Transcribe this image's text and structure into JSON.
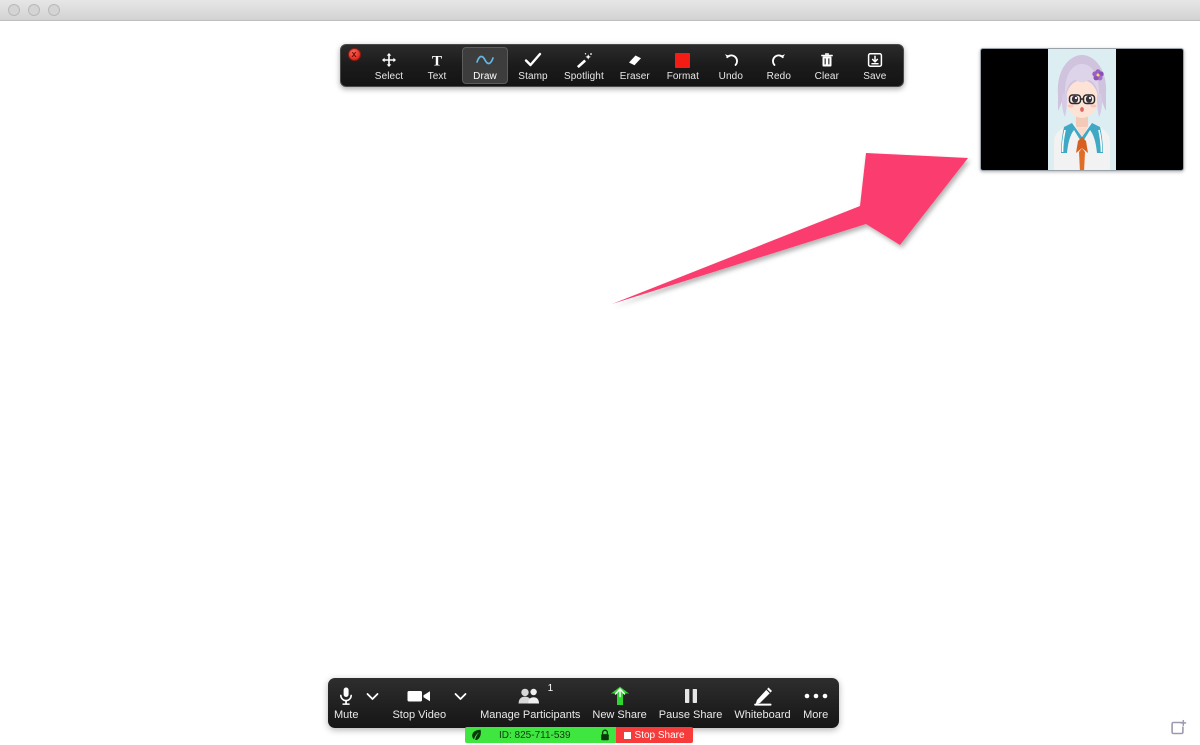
{
  "window": {
    "platform": "macos",
    "traffic_lights": [
      "close",
      "minimize",
      "zoom"
    ],
    "canvas_background": "#ffffff"
  },
  "annotation_toolbar": {
    "close_glyph": "x",
    "active_tool": "Draw",
    "tools": [
      {
        "label": "Select",
        "icon": "move-arrows-icon"
      },
      {
        "label": "Text",
        "icon": "text-T-icon"
      },
      {
        "label": "Draw",
        "icon": "wave-line-icon"
      },
      {
        "label": "Stamp",
        "icon": "checkmark-icon"
      },
      {
        "label": "Spotlight",
        "icon": "magic-wand-icon"
      },
      {
        "label": "Eraser",
        "icon": "eraser-icon"
      },
      {
        "label": "Format",
        "icon": "color-swatch-icon"
      },
      {
        "label": "Undo",
        "icon": "undo-arrow-icon"
      },
      {
        "label": "Redo",
        "icon": "redo-arrow-icon"
      },
      {
        "label": "Clear",
        "icon": "trash-icon"
      },
      {
        "label": "Save",
        "icon": "save-download-icon"
      }
    ],
    "format_color": "#f51c16"
  },
  "annotation": {
    "shape": "arrow",
    "color": "#fa3c6e",
    "direction": "up-right",
    "points_at": "self-view-thumbnail"
  },
  "self_view": {
    "background": "#000000",
    "avatar": "anime-girl-avatar"
  },
  "bottom_bar": {
    "controls": [
      {
        "label": "Mute",
        "icon": "microphone-icon",
        "has_caret": true
      },
      {
        "label": "Stop Video",
        "icon": "video-camera-icon",
        "has_caret": true
      },
      {
        "label": "Manage Participants",
        "icon": "participants-icon",
        "badge": "1"
      },
      {
        "label": "New Share",
        "icon": "share-up-arrow-icon",
        "accent": "#3fe63f"
      },
      {
        "label": "Pause Share",
        "icon": "pause-icon"
      },
      {
        "label": "Whiteboard",
        "icon": "pencil-icon"
      },
      {
        "label": "More",
        "icon": "ellipsis-icon"
      }
    ]
  },
  "meeting_strip": {
    "leaf_icon": "leaf-icon",
    "id_text": "ID: 825-711-539",
    "lock_icon": "lock-icon",
    "stop_share_label": "Stop Share",
    "green": "#3fe63f",
    "red": "#f73b3b"
  },
  "corner": {
    "icon": "new-window-plus-icon"
  }
}
